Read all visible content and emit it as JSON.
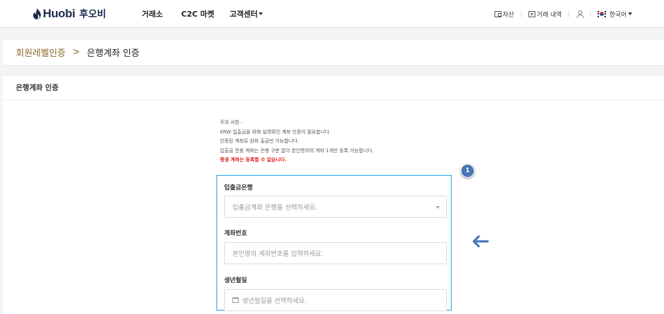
{
  "header": {
    "brand": "Huobi",
    "brand_ko": "후오비",
    "nav": [
      {
        "label": "거래소"
      },
      {
        "label": "C2C 마켓"
      },
      {
        "label": "고객센터"
      }
    ],
    "right": {
      "assets": "자산",
      "trade_history": "거래 내역",
      "language": "한국어"
    }
  },
  "breadcrumb": {
    "parent": "회원레벨인증",
    "separator": ">",
    "current": "은행계좌 인증"
  },
  "panel": {
    "title": "은행계좌 인증"
  },
  "notice": {
    "heading": "주의 사항 :",
    "lines": [
      "KRW 입출금을 위해 실명확인 계좌 인증이 필요합니다.",
      "인증된 계좌로 원화 출금만 가능합니다.",
      "입출금 전용 계좌는 은행 구분 없이 본인명의의 계좌 1개만 등록 가능합니다."
    ],
    "warning": "평생 계좌는 등록할 수 없습니다."
  },
  "badge": "1",
  "form": {
    "bank": {
      "label": "입출금은행",
      "placeholder": "입출금계좌 은행을 선택하세요."
    },
    "account": {
      "label": "계좌번호",
      "placeholder": "본인명의 계좌번호를 입력하세요."
    },
    "birth": {
      "label": "생년월일",
      "placeholder": "생년월일을 선택하세요."
    }
  },
  "colors": {
    "highlight_border": "#1aa3e0",
    "badge": "#4a76b5",
    "arrow": "#4a76b5",
    "warning": "#e2221f",
    "breadcrumb_link": "#8a6a2e"
  },
  "icons": [
    "huobi-flame-icon",
    "wallet-icon",
    "document-icon",
    "user-icon",
    "korea-flag-icon",
    "calendar-icon",
    "arrow-left-icon",
    "chevron-down-icon"
  ]
}
